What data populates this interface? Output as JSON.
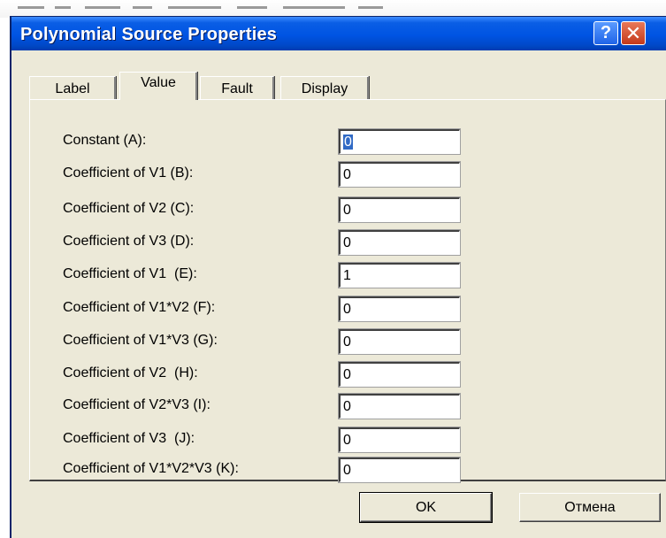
{
  "window": {
    "title": "Polynomial Source Properties",
    "help_glyph": "?",
    "close_glyph": "✕"
  },
  "tabs": [
    {
      "label": "Label",
      "active": false
    },
    {
      "label": "Value",
      "active": true
    },
    {
      "label": "Fault",
      "active": false
    },
    {
      "label": "Display",
      "active": false
    }
  ],
  "fields": [
    {
      "label": "Constant (A):",
      "value": "0"
    },
    {
      "label": "Coefficient of V1 (B):",
      "value": "0"
    },
    {
      "label": "Coefficient of V2 (C):",
      "value": "0"
    },
    {
      "label": "Coefficient of V3 (D):",
      "value": "0"
    },
    {
      "label": "Coefficient of V1  (E):",
      "value": "1"
    },
    {
      "label": "Coefficient of V1*V2 (F):",
      "value": "0"
    },
    {
      "label": "Coefficient of V1*V3 (G):",
      "value": "0"
    },
    {
      "label": "Coefficient of V2  (H):",
      "value": "0"
    },
    {
      "label": "Coefficient of V2*V3 (I):",
      "value": "0"
    },
    {
      "label": "Coefficient of V3  (J):",
      "value": "0"
    },
    {
      "label": "Coefficient of V1*V2*V3 (K):",
      "value": "0"
    }
  ],
  "buttons": {
    "ok_label": "OK",
    "cancel_label": "Отмена"
  },
  "colors": {
    "titlebar": "#0054e3",
    "dialog_face": "#ece9d8",
    "close_button": "#c4391a",
    "selection": "#316ac5"
  }
}
